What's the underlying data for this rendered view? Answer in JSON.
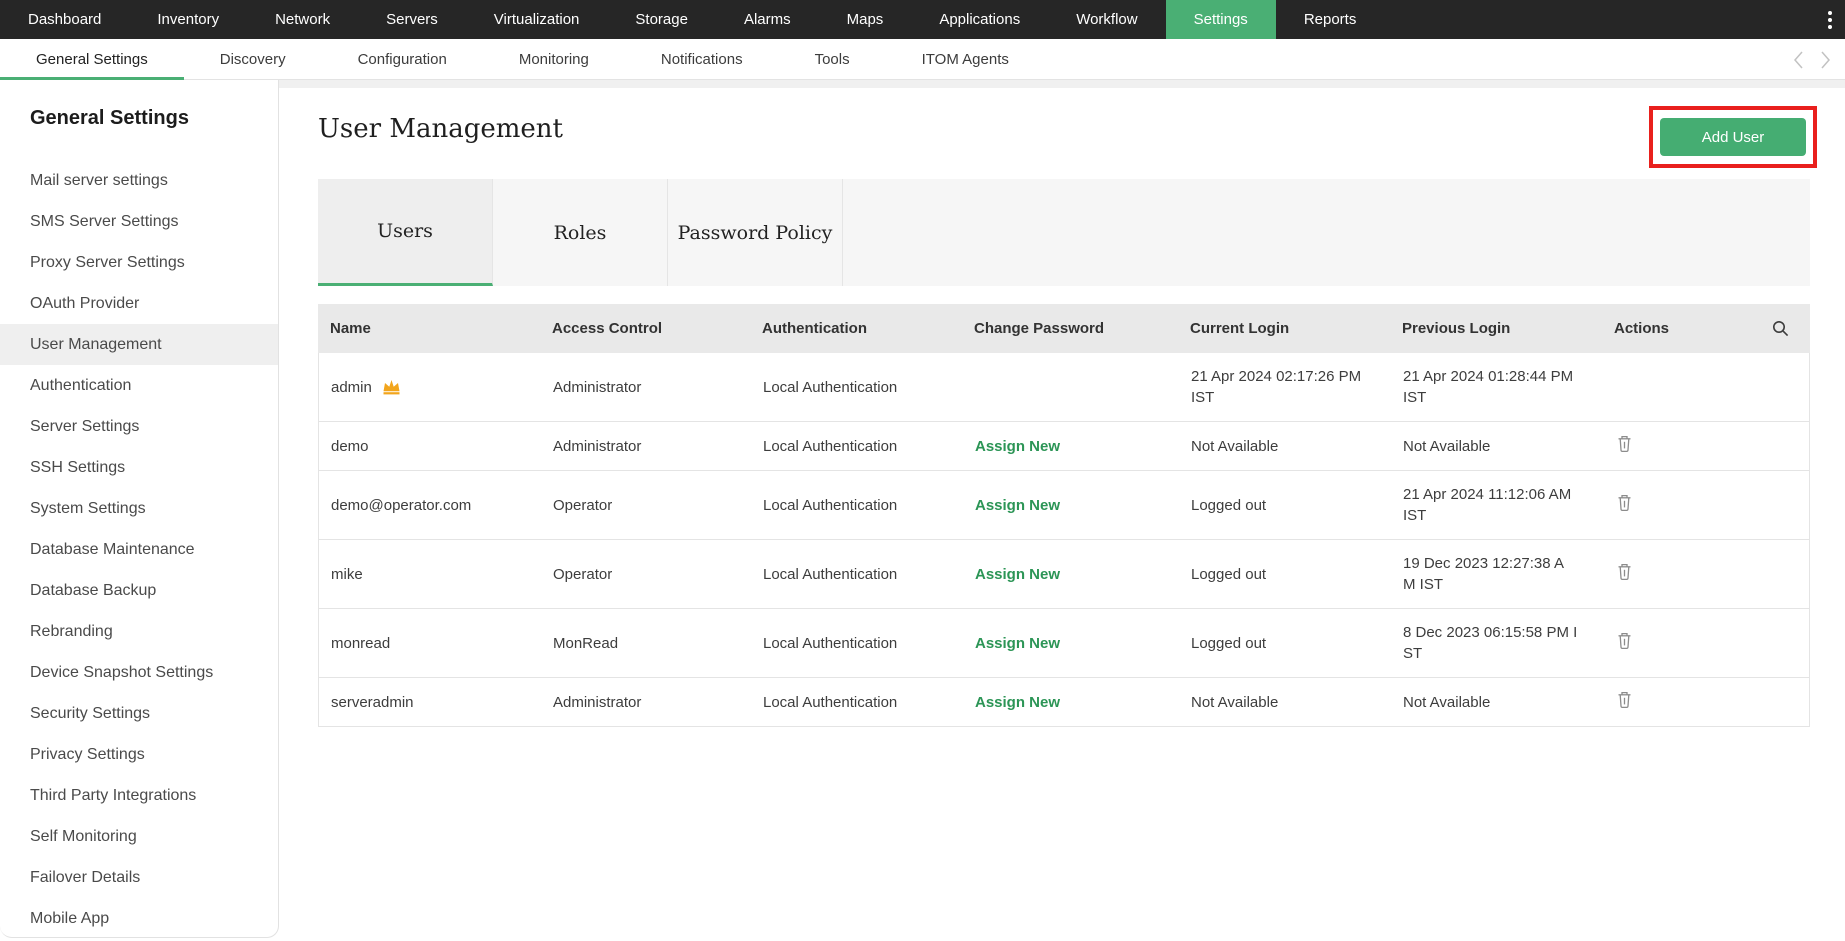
{
  "nav": {
    "items": [
      {
        "label": "Dashboard",
        "active": false
      },
      {
        "label": "Inventory",
        "active": false
      },
      {
        "label": "Network",
        "active": false
      },
      {
        "label": "Servers",
        "active": false
      },
      {
        "label": "Virtualization",
        "active": false
      },
      {
        "label": "Storage",
        "active": false
      },
      {
        "label": "Alarms",
        "active": false
      },
      {
        "label": "Maps",
        "active": false
      },
      {
        "label": "Applications",
        "active": false
      },
      {
        "label": "Workflow",
        "active": false
      },
      {
        "label": "Settings",
        "active": true
      },
      {
        "label": "Reports",
        "active": false
      }
    ]
  },
  "subnav": {
    "items": [
      {
        "label": "General Settings",
        "active": true
      },
      {
        "label": "Discovery",
        "active": false
      },
      {
        "label": "Configuration",
        "active": false
      },
      {
        "label": "Monitoring",
        "active": false
      },
      {
        "label": "Notifications",
        "active": false
      },
      {
        "label": "Tools",
        "active": false
      },
      {
        "label": "ITOM Agents",
        "active": false
      }
    ]
  },
  "sidebar": {
    "heading": "General Settings",
    "items": [
      {
        "label": "Mail server settings",
        "selected": false
      },
      {
        "label": "SMS Server Settings",
        "selected": false
      },
      {
        "label": "Proxy Server Settings",
        "selected": false
      },
      {
        "label": "OAuth Provider",
        "selected": false
      },
      {
        "label": "User Management",
        "selected": true
      },
      {
        "label": "Authentication",
        "selected": false
      },
      {
        "label": "Server Settings",
        "selected": false
      },
      {
        "label": "SSH Settings",
        "selected": false
      },
      {
        "label": "System Settings",
        "selected": false
      },
      {
        "label": "Database Maintenance",
        "selected": false
      },
      {
        "label": "Database Backup",
        "selected": false
      },
      {
        "label": "Rebranding",
        "selected": false
      },
      {
        "label": "Device Snapshot Settings",
        "selected": false
      },
      {
        "label": "Security Settings",
        "selected": false
      },
      {
        "label": "Privacy Settings",
        "selected": false
      },
      {
        "label": "Third Party Integrations",
        "selected": false
      },
      {
        "label": "Self Monitoring",
        "selected": false
      },
      {
        "label": "Failover Details",
        "selected": false
      },
      {
        "label": "Mobile App",
        "selected": false
      }
    ]
  },
  "main": {
    "title": "User Management",
    "add_user_label": "Add User",
    "tabs": [
      {
        "label": "Users",
        "active": true
      },
      {
        "label": "Roles",
        "active": false
      },
      {
        "label": "Password Policy",
        "active": false
      }
    ],
    "table": {
      "columns": [
        "Name",
        "Access Control",
        "Authentication",
        "Change Password",
        "Current Login",
        "Previous Login",
        "Actions"
      ],
      "rows": [
        {
          "name": "admin",
          "crown": true,
          "access_control": "Administrator",
          "authentication": "Local Authentication",
          "change_password": "",
          "current_login": "21 Apr 2024 02:17:26 PM\nIST",
          "previous_login": "21 Apr 2024 01:28:44 PM\nIST",
          "deletable": false
        },
        {
          "name": "demo",
          "crown": false,
          "access_control": "Administrator",
          "authentication": "Local Authentication",
          "change_password": "Assign New",
          "current_login": "Not Available",
          "previous_login": "Not Available",
          "deletable": true
        },
        {
          "name": "demo@operator.com",
          "crown": false,
          "access_control": "Operator",
          "authentication": "Local Authentication",
          "change_password": "Assign New",
          "current_login": "Logged out",
          "previous_login": "21 Apr 2024 11:12:06 AM\nIST",
          "deletable": true
        },
        {
          "name": "mike",
          "crown": false,
          "access_control": "Operator",
          "authentication": "Local Authentication",
          "change_password": "Assign New",
          "current_login": "Logged out",
          "previous_login": "19 Dec 2023 12:27:38 A\nM IST",
          "deletable": true
        },
        {
          "name": "monread",
          "crown": false,
          "access_control": "MonRead",
          "authentication": "Local Authentication",
          "change_password": "Assign New",
          "current_login": "Logged out",
          "previous_login": "8 Dec 2023 06:15:58 PM I\nST",
          "deletable": true
        },
        {
          "name": "serveradmin",
          "crown": false,
          "access_control": "Administrator",
          "authentication": "Local Authentication",
          "change_password": "Assign New",
          "current_login": "Not Available",
          "previous_login": "Not Available",
          "deletable": true
        }
      ]
    }
  },
  "icons": {
    "kebab": "kebab-menu-icon",
    "prev": "chevron-left-icon",
    "next": "chevron-right-icon",
    "search": "search-icon",
    "crown": "crown-icon",
    "trash": "trash-icon"
  },
  "colors": {
    "nav_bg": "#262626",
    "accent_green": "#4aaf74",
    "button_green": "#45ad72",
    "link_green": "#2c9556",
    "annotation_red": "#e9201d",
    "crown_gold": "#f2a51c"
  }
}
